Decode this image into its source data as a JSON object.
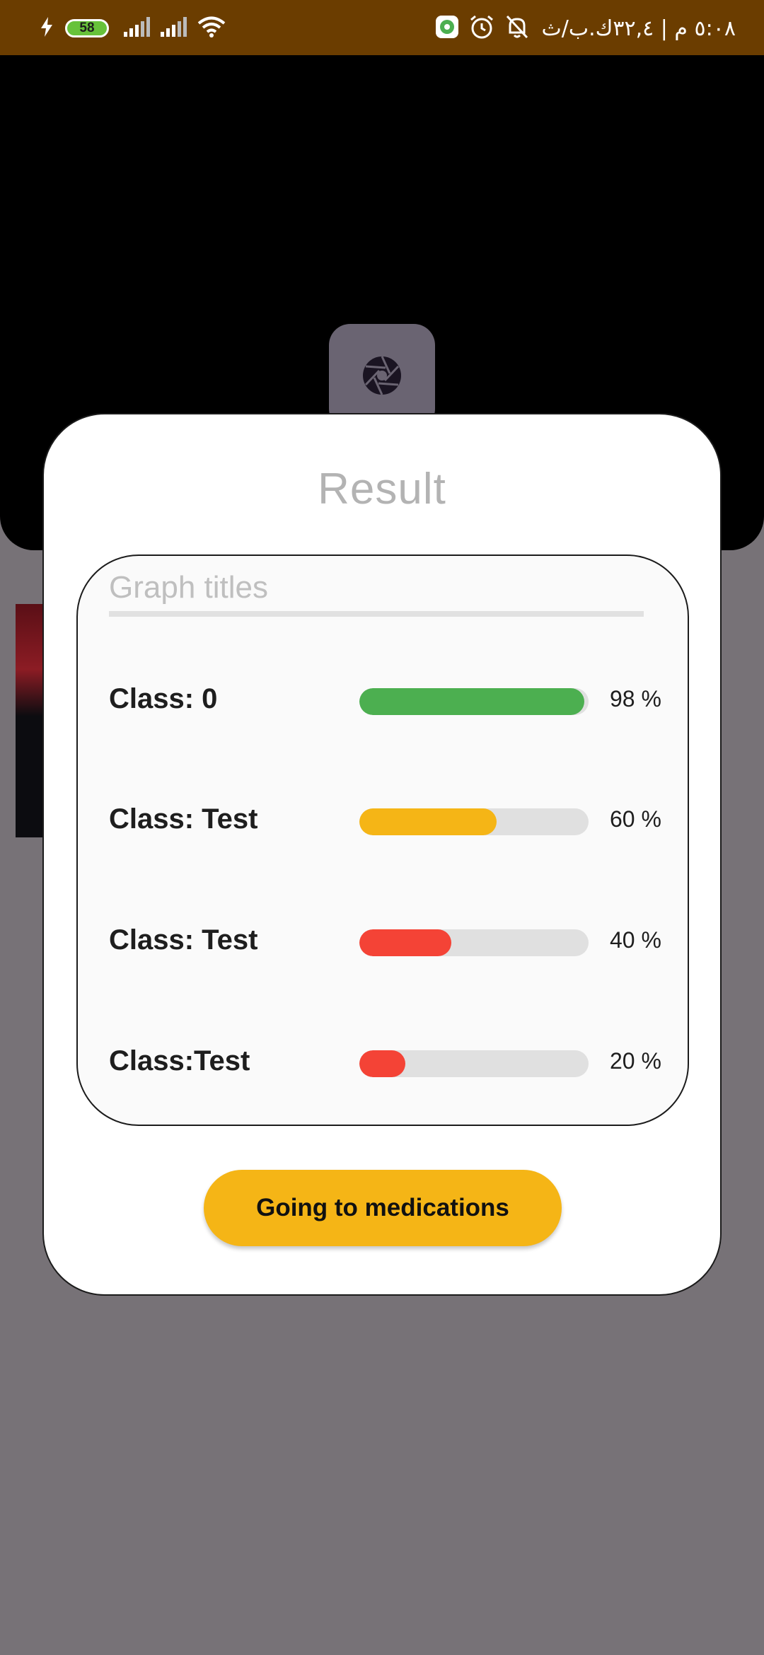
{
  "status_bar": {
    "battery_level": "58",
    "time_text": "٥:٠٨ م | ٣٢,٤ك.ب/ث",
    "icons": [
      "charging-icon",
      "battery-icon",
      "signal-1-icon",
      "signal-2-icon",
      "wifi-icon",
      "app-settings-icon",
      "alarm-icon",
      "mute-icon"
    ]
  },
  "camera": {
    "shutter_icon": "aperture-icon"
  },
  "dialog": {
    "title": "Result",
    "graph": {
      "title": "Graph titles",
      "items": [
        {
          "label": "Class: 0",
          "percent_text": "98 %",
          "value": 98,
          "color": "#4caf50"
        },
        {
          "label": "Class: Test",
          "percent_text": "60 %",
          "value": 60,
          "color": "#f5b516"
        },
        {
          "label": "Class: Test",
          "percent_text": "40 %",
          "value": 40,
          "color": "#f44336"
        },
        {
          "label": "Class:Test",
          "percent_text": "20 %",
          "value": 20,
          "color": "#f44336"
        }
      ]
    },
    "action_button_label": "Going to medications"
  },
  "colors": {
    "status_bar": "#6b3d00",
    "accent": "#f5b516",
    "overlay": "#777277"
  }
}
